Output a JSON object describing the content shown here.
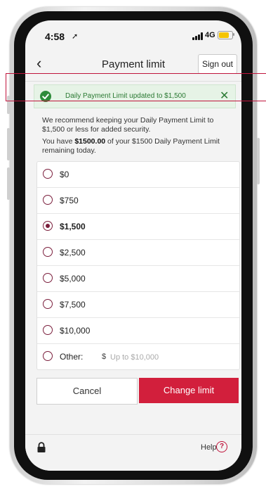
{
  "status": {
    "time": "4:58",
    "network": "4G"
  },
  "nav": {
    "title": "Payment limit",
    "sign_out_label": "Sign out"
  },
  "banner": {
    "message": "Daily Payment Limit updated to $1,500"
  },
  "info": {
    "recommend": "We recommend keeping your Daily Payment Limit to $1,500 or less for added security.",
    "remaining_prefix": "You have ",
    "remaining_amount": "$1500.00",
    "remaining_suffix": " of your $1500 Daily Payment Limit remaining today."
  },
  "options": [
    {
      "label": "$0",
      "selected": false
    },
    {
      "label": "$750",
      "selected": false
    },
    {
      "label": "$1,500",
      "selected": true
    },
    {
      "label": "$2,500",
      "selected": false
    },
    {
      "label": "$5,000",
      "selected": false
    },
    {
      "label": "$7,500",
      "selected": false
    },
    {
      "label": "$10,000",
      "selected": false
    }
  ],
  "other": {
    "label": "Other:",
    "prefix": "$",
    "placeholder": "Up to $10,000",
    "value": ""
  },
  "buttons": {
    "cancel_label": "Cancel",
    "change_label": "Change limit"
  },
  "footer": {
    "help_label": "Help"
  },
  "colors": {
    "primary": "#d21f3c",
    "radio": "#7a1d3b",
    "success_bg": "#e6f3e6",
    "success_text": "#2a7a33"
  }
}
